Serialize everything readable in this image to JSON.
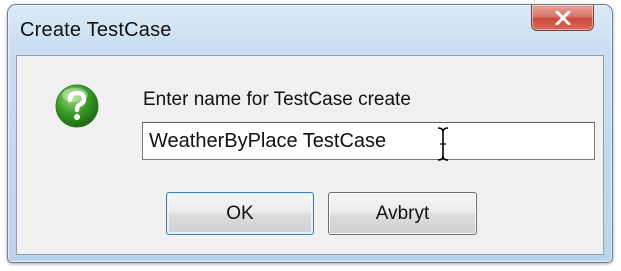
{
  "window": {
    "title": "Create TestCase",
    "close_icon": "close-x-icon"
  },
  "prompt": {
    "icon": "question-icon",
    "label": "Enter name for TestCase create",
    "input_value": "WeatherByPlace TestCase"
  },
  "buttons": {
    "ok_label": "OK",
    "cancel_label": "Avbryt"
  },
  "colors": {
    "icon_green": "#3a9a28",
    "close_red": "#c94b3b",
    "frame_blue": "#bcd4eb",
    "default_button_border": "#3c7fb1"
  }
}
